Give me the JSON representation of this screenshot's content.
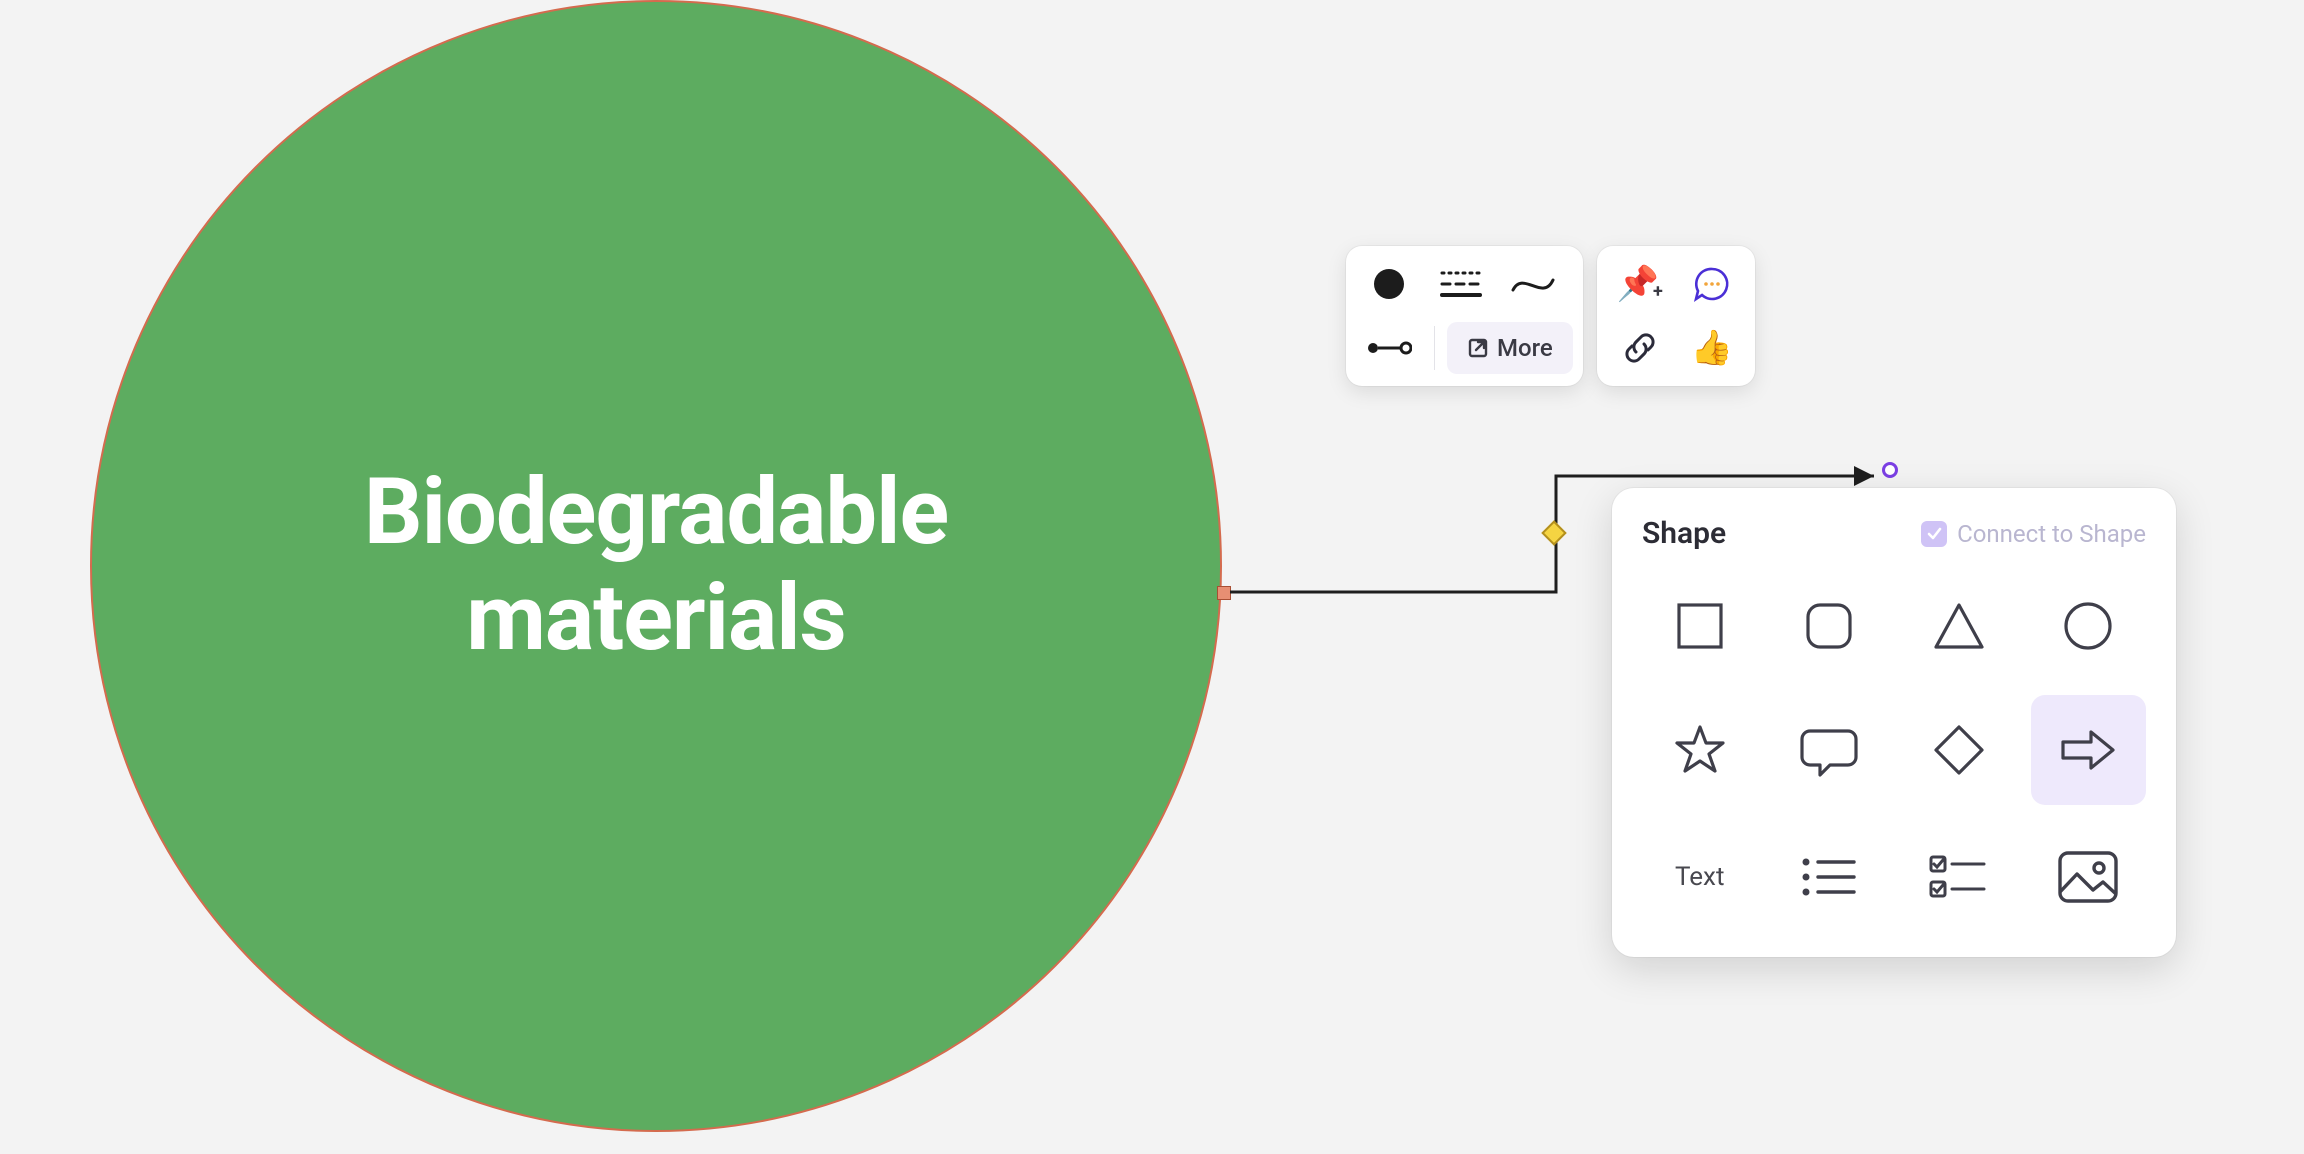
{
  "node": {
    "label": "Biodegradable\nmaterials",
    "fill": "#5dac60",
    "stroke": "#d46b4e"
  },
  "toolbar": {
    "more_label": "More",
    "buttons": {
      "fill": "fill-color",
      "border": "border-style",
      "line_curve": "line-curve",
      "connector": "connector-tool",
      "pin": "pin",
      "comment": "comment",
      "link": "link",
      "thumbs_up": "thumbs-up"
    }
  },
  "shape_panel": {
    "title": "Shape",
    "connect_label": "Connect to Shape",
    "connect_checked": true,
    "shapes": [
      {
        "id": "square",
        "selected": false
      },
      {
        "id": "rounded-square",
        "selected": false
      },
      {
        "id": "triangle",
        "selected": false
      },
      {
        "id": "circle",
        "selected": false
      },
      {
        "id": "star",
        "selected": false
      },
      {
        "id": "speech-bubble",
        "selected": false
      },
      {
        "id": "diamond",
        "selected": false
      },
      {
        "id": "arrow-right",
        "selected": true
      }
    ],
    "bottom": {
      "text_label": "Text",
      "bulleted_list": "bulleted-list",
      "checklist": "checklist",
      "image": "image"
    }
  }
}
